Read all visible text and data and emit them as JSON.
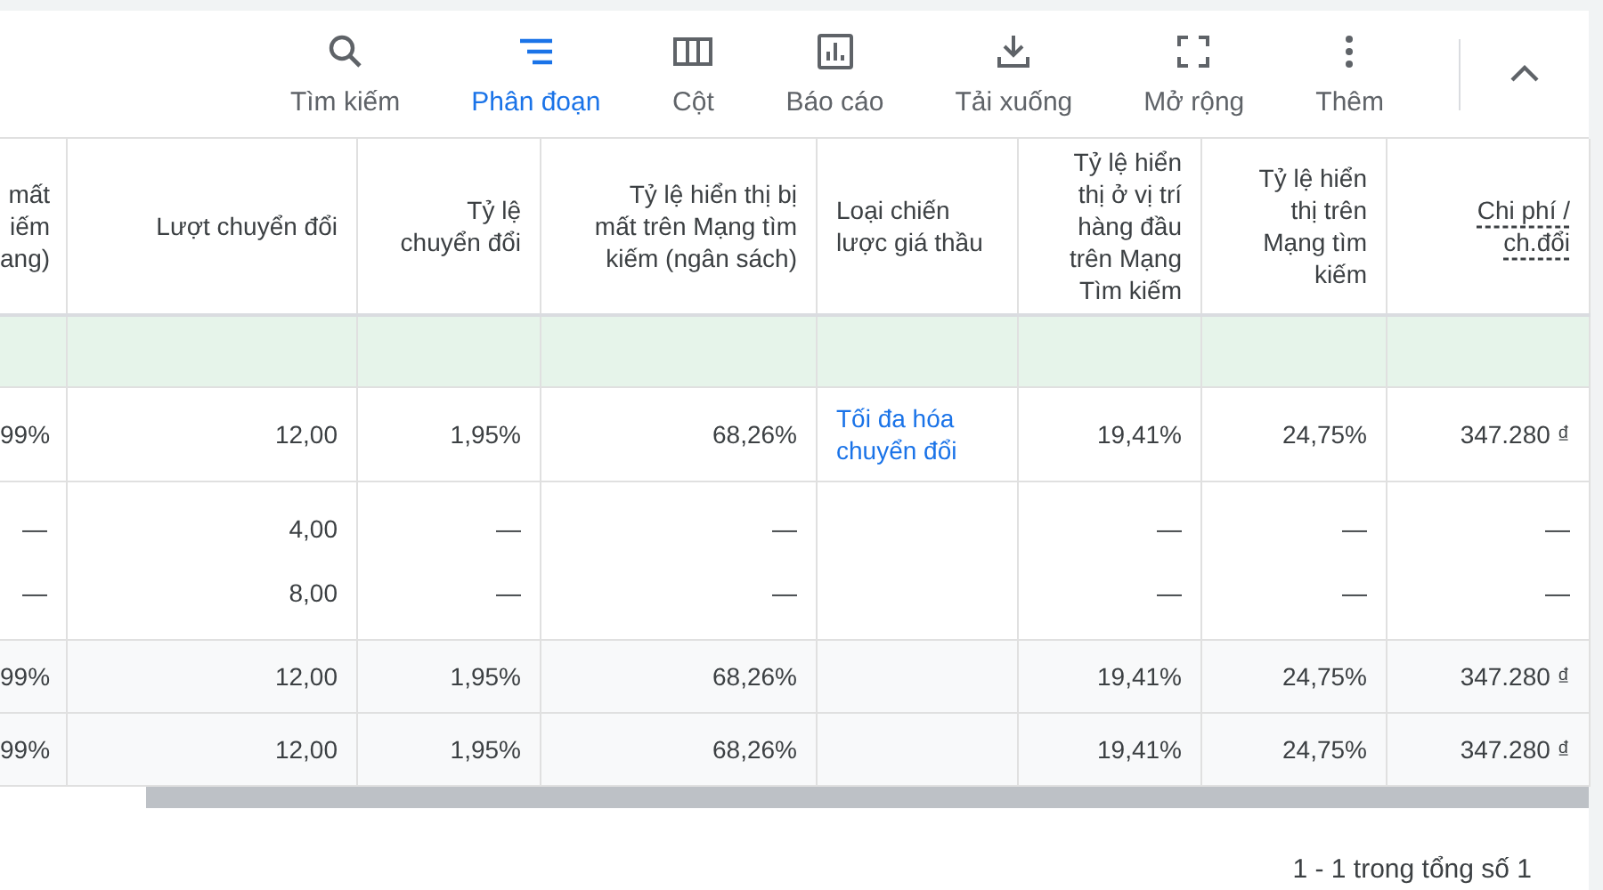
{
  "toolbar": {
    "items": [
      {
        "label": "Tìm kiếm",
        "selected": false
      },
      {
        "label": "Phân đoạn",
        "selected": true
      },
      {
        "label": "Cột",
        "selected": false
      },
      {
        "label": "Báo cáo",
        "selected": false
      },
      {
        "label": "Tải xuống",
        "selected": false
      },
      {
        "label": "Mở rộng",
        "selected": false
      },
      {
        "label": "Thêm",
        "selected": false
      }
    ],
    "collapse": {
      "expanded": true
    }
  },
  "table": {
    "columns": [
      {
        "label": "mất\niếm\nang)",
        "underlined": false
      },
      {
        "label": "Lượt chuyển đổi",
        "underlined": false
      },
      {
        "label": "Tỷ lệ\nchuyển đổi",
        "underlined": false
      },
      {
        "label": "Tỷ lệ hiển thị bị\nmất trên Mạng tìm\nkiếm (ngân sách)",
        "underlined": false
      },
      {
        "label": "Loại chiến\nlược giá thầu",
        "underlined": false
      },
      {
        "label": "Tỷ lệ hiển\nthị ở vị trí\nhàng đầu\ntrên Mạng\nTìm kiếm",
        "underlined": false
      },
      {
        "label": "Tỷ lệ hiển\nthị trên\nMạng tìm\nkiếm",
        "underlined": false
      },
      {
        "label": "Chi phí /\nch.đổi",
        "underlined": true
      }
    ],
    "rows": [
      {
        "kind": "highlight",
        "cells": [
          {},
          {},
          {},
          {},
          {},
          {},
          {},
          {}
        ]
      },
      {
        "kind": "data",
        "cells": [
          {
            "text": "99%"
          },
          {
            "text": "12,00"
          },
          {
            "text": "1,95%"
          },
          {
            "text": "68,26%"
          },
          {
            "text": "Tối đa hóa\nchuyển đổi",
            "kind": "link"
          },
          {
            "text": "19,41%"
          },
          {
            "text": "24,75%"
          },
          {
            "text": "347.280 ₫"
          }
        ]
      },
      {
        "kind": "data",
        "cells": [
          {
            "text": "—\n—"
          },
          {
            "text": "4,00\n8,00"
          },
          {
            "text": "—\n—"
          },
          {
            "text": "—\n—"
          },
          {},
          {
            "text": "—\n—"
          },
          {
            "text": "—\n—"
          },
          {
            "text": "—\n—"
          }
        ]
      },
      {
        "kind": "total",
        "cells": [
          {
            "text": "99%"
          },
          {
            "text": "12,00"
          },
          {
            "text": "1,95%"
          },
          {
            "text": "68,26%"
          },
          {},
          {
            "text": "19,41%"
          },
          {
            "text": "24,75%"
          },
          {
            "text": "347.280 ₫"
          }
        ]
      },
      {
        "kind": "total",
        "cells": [
          {
            "text": "99%"
          },
          {
            "text": "12,00"
          },
          {
            "text": "1,95%"
          },
          {
            "text": "68,26%"
          },
          {},
          {
            "text": "19,41%"
          },
          {
            "text": "24,75%"
          },
          {
            "text": "347.280 ₫"
          }
        ]
      }
    ]
  },
  "pagination": "1 - 1 trong tổng số 1"
}
